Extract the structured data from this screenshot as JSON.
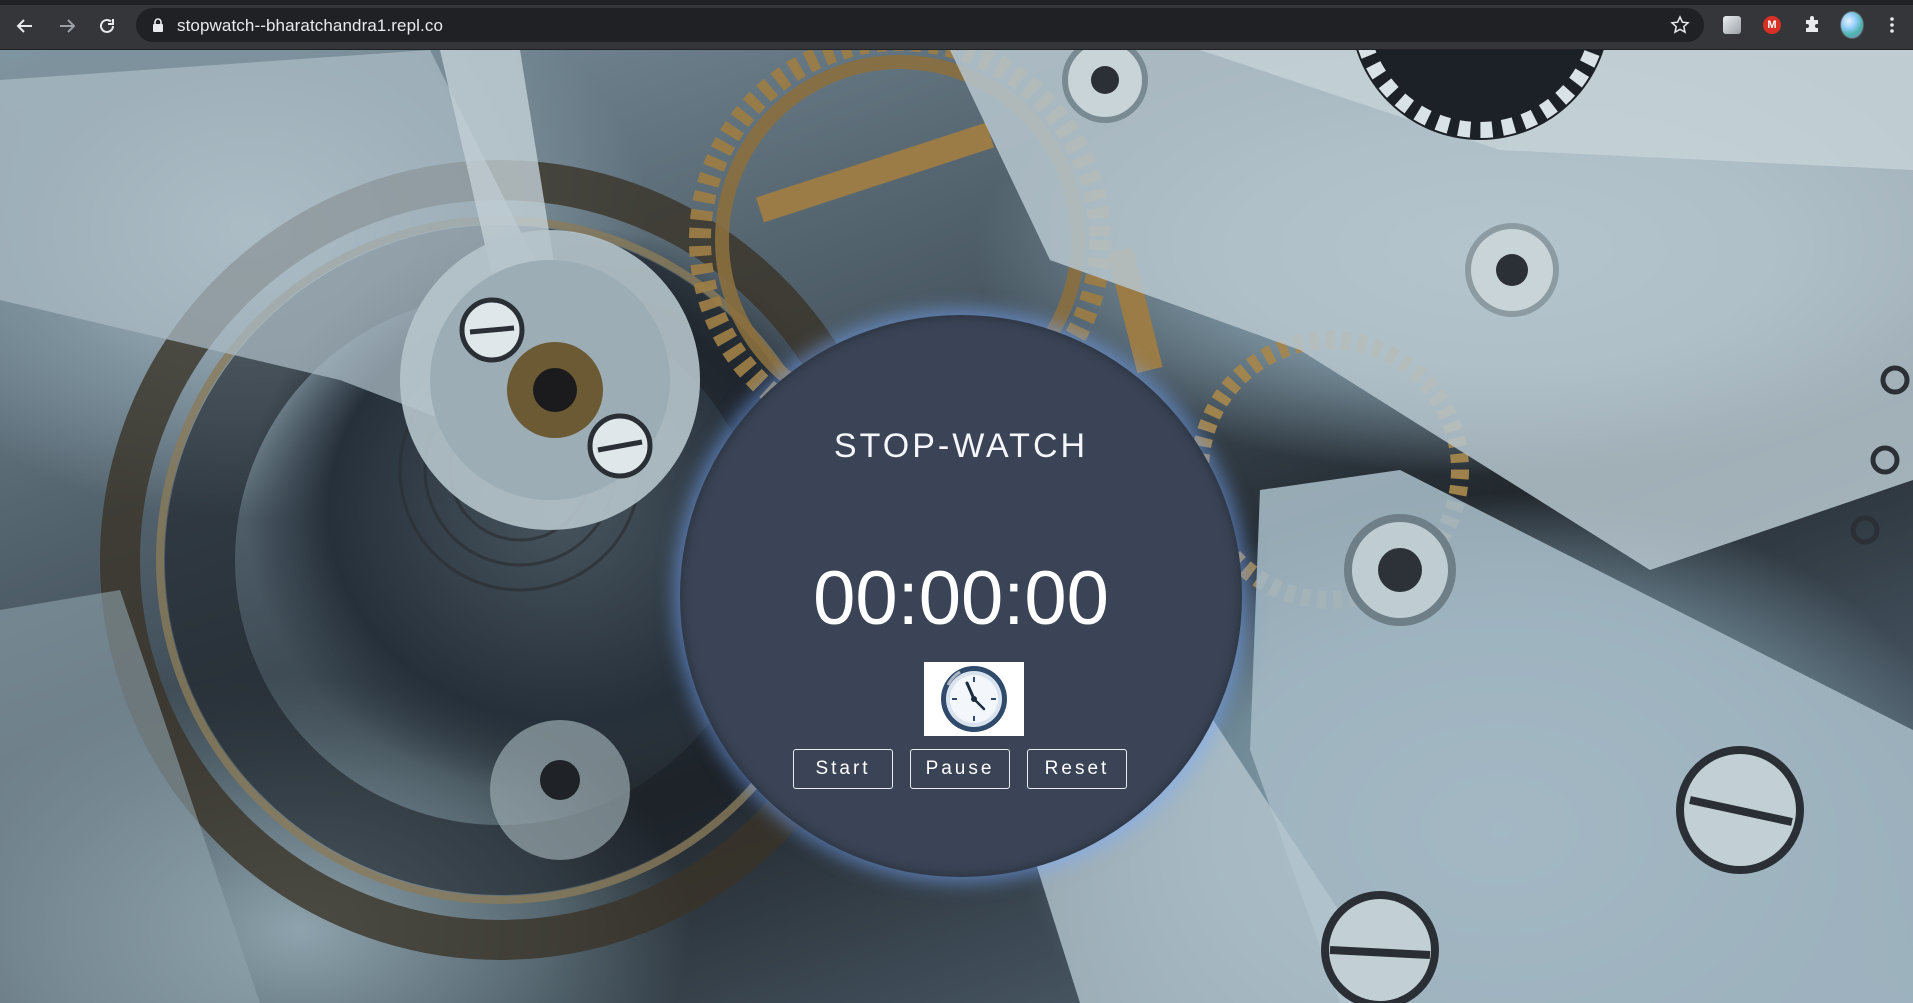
{
  "browser": {
    "url": "stopwatch--bharatchandra1.repl.co",
    "icons": {
      "back": "arrow-left-icon",
      "forward": "arrow-right-icon",
      "reload": "reload-icon",
      "lock": "lock-icon",
      "bookmark": "star-icon",
      "extension_1": "extension-square-icon",
      "extension_2": "m-circle-icon",
      "extensions": "puzzle-icon",
      "profile": "profile-avatar",
      "menu": "kebab-menu-icon"
    },
    "extension_2_letter": "M"
  },
  "stopwatch": {
    "title": "STOP-WATCH",
    "time": "00:00:00",
    "image": "clock-icon",
    "buttons": {
      "start": "Start",
      "pause": "Pause",
      "reset": "Reset"
    }
  },
  "colors": {
    "panel": "#3a4456",
    "glow": "#78aaff",
    "text": "#ffffff",
    "chrome": "#35363a",
    "omnibox": "#202124"
  }
}
